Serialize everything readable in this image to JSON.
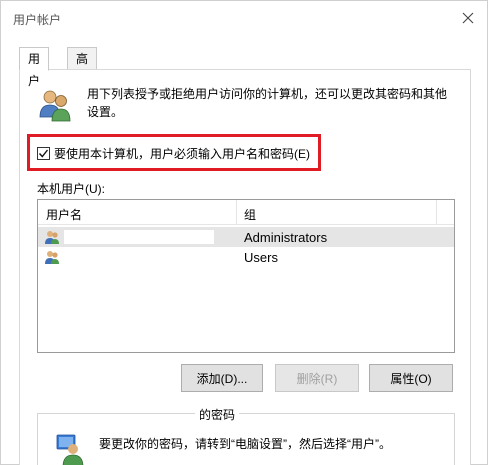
{
  "window": {
    "title": "用户帐户"
  },
  "tabs": [
    {
      "label": "用户"
    },
    {
      "label": "高级"
    }
  ],
  "info": {
    "text": "用下列表授予或拒绝用户访问你的计算机，还可以更改其密码和其他设置。"
  },
  "checkbox": {
    "label": "要使用本计算机，用户必须输入用户名和密码(E)",
    "checked": true
  },
  "users": {
    "label": "本机用户(U):",
    "columns": [
      "用户名",
      "组"
    ],
    "rows": [
      {
        "name": "",
        "group": "Administrators",
        "selected": true
      },
      {
        "name": "",
        "group": "Users",
        "selected": false
      }
    ]
  },
  "buttons": {
    "add": "添加(D)...",
    "remove": "删除(R)",
    "properties": "属性(O)"
  },
  "password": {
    "group_title": "的密码",
    "text": "要更改你的密码，请转到“电脑设置”，然后选择“用户”。"
  },
  "colors": {
    "highlight": "#e01b24",
    "selection": "#e5e5e5"
  },
  "icons": [
    "close-icon",
    "users-icon",
    "checkmark-icon",
    "user-icon",
    "password-icon"
  ]
}
